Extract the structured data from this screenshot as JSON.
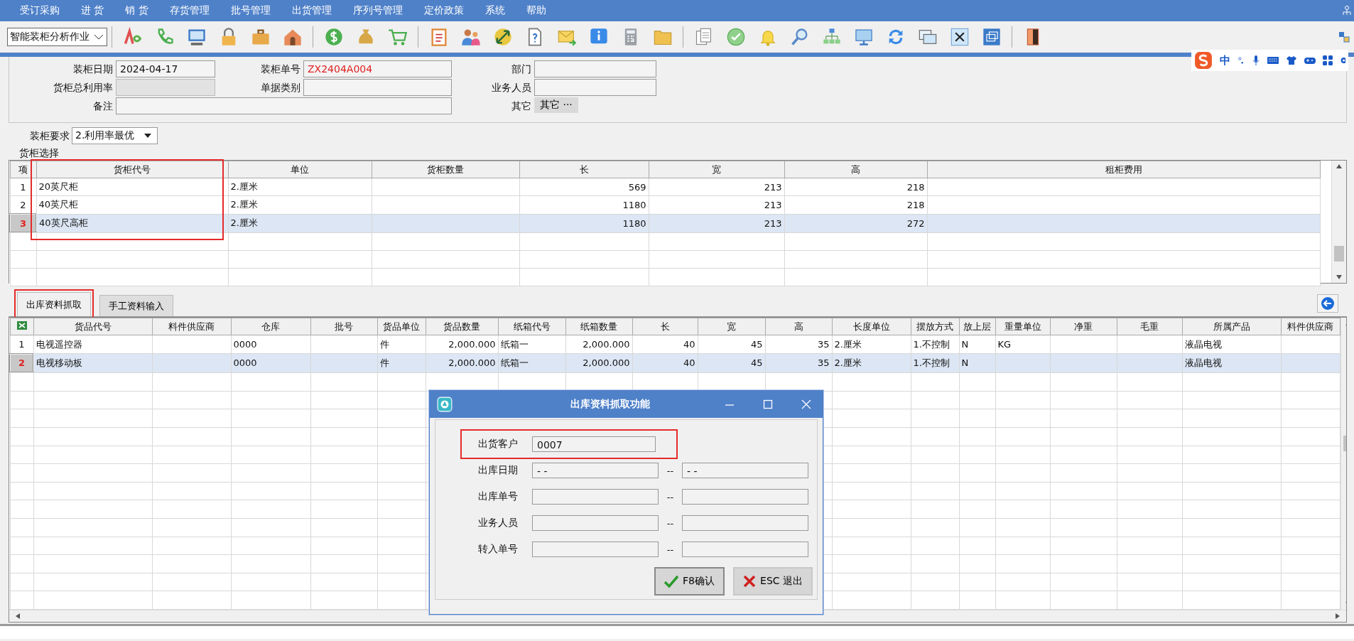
{
  "menu": [
    "受订采购",
    "进 货",
    "销 货",
    "存货管理",
    "批号管理",
    "出货管理",
    "序列号管理",
    "定价政策",
    "系统",
    "帮助"
  ],
  "toolbar": {
    "module_select": "智能装柜分析作业"
  },
  "ime_bar": {
    "mode": "中"
  },
  "form": {
    "fields": [
      {
        "label": "装柜日期",
        "value": "2024-04-17",
        "kind": "text"
      },
      {
        "label": "装柜单号",
        "value": "ZX2404A004",
        "kind": "code"
      },
      {
        "label": "部门",
        "kind": "text"
      },
      {
        "label": "货柜总利用率",
        "kind": "readonly"
      },
      {
        "label": "单据类别",
        "kind": "text"
      },
      {
        "label": "业务人员",
        "kind": "text"
      },
      {
        "label": "备注",
        "kind": "wide"
      },
      {
        "label": "其它",
        "value": "其它 ···",
        "kind": "button"
      }
    ]
  },
  "requirement": {
    "label": "装柜要求",
    "value": "2.利用率最优"
  },
  "container_section": {
    "title": "货柜选择",
    "columns": [
      {
        "label": "项",
        "kind": "index"
      },
      {
        "label": "货柜代号",
        "kind": "text"
      },
      {
        "label": "单位",
        "kind": "text"
      },
      {
        "label": "货柜数量",
        "kind": "number"
      },
      {
        "label": "长",
        "kind": "number"
      },
      {
        "label": "宽",
        "kind": "number"
      },
      {
        "label": "高",
        "kind": "number"
      },
      {
        "label": "租柜费用",
        "kind": "number"
      }
    ],
    "rows": [
      {
        "selected": false,
        "cells": [
          "1",
          "20英尺柜",
          "2.厘米",
          "",
          "569",
          "213",
          "218",
          ""
        ]
      },
      {
        "selected": false,
        "cells": [
          "2",
          "40英尺柜",
          "2.厘米",
          "",
          "1180",
          "213",
          "218",
          ""
        ]
      },
      {
        "selected": true,
        "cells": [
          "3",
          "40英尺高柜",
          "2.厘米",
          "",
          "1180",
          "213",
          "272",
          ""
        ]
      }
    ]
  },
  "tabs": [
    {
      "label": "出库资料抓取",
      "selected": true
    },
    {
      "label": "手工资料输入",
      "selected": false
    }
  ],
  "goods_table": {
    "columns": [
      {
        "kind": "index"
      },
      {
        "label": "货品代号",
        "kind": "text"
      },
      {
        "label": "料件供应商",
        "kind": "text"
      },
      {
        "label": "仓库",
        "kind": "text"
      },
      {
        "label": "批号",
        "kind": "text"
      },
      {
        "label": "货品单位",
        "kind": "text"
      },
      {
        "label": "货品数量",
        "kind": "number"
      },
      {
        "label": "纸箱代号",
        "kind": "text"
      },
      {
        "label": "纸箱数量",
        "kind": "number"
      },
      {
        "label": "长",
        "kind": "number"
      },
      {
        "label": "宽",
        "kind": "number"
      },
      {
        "label": "高",
        "kind": "number"
      },
      {
        "label": "长度单位",
        "kind": "text"
      },
      {
        "label": "摆放方式",
        "kind": "text"
      },
      {
        "label": "放上层",
        "kind": "text"
      },
      {
        "label": "重量单位",
        "kind": "text"
      },
      {
        "label": "净重",
        "kind": "number"
      },
      {
        "label": "毛重",
        "kind": "number"
      },
      {
        "label": "所属产品",
        "kind": "text"
      },
      {
        "label": "料件供应商",
        "kind": "text"
      }
    ],
    "rows": [
      {
        "selected": false,
        "cells": [
          "1",
          "电视遥控器",
          "",
          "0000",
          "",
          "件",
          "2,000.000",
          "纸箱一",
          "2,000.000",
          "40",
          "45",
          "35",
          "2.厘米",
          "1.不控制",
          "N",
          "KG",
          "",
          "",
          "液晶电视",
          ""
        ]
      },
      {
        "selected": true,
        "cells": [
          "2",
          "电视移动板",
          "",
          "0000",
          "",
          "件",
          "2,000.000",
          "纸箱一",
          "2,000.000",
          "40",
          "45",
          "35",
          "2.厘米",
          "1.不控制",
          "N",
          "",
          "",
          "",
          "液晶电视",
          ""
        ]
      }
    ]
  },
  "dialog": {
    "title": "出库资料抓取功能",
    "rows": [
      {
        "label": "出货客户",
        "kind": "single",
        "from": "0007"
      },
      {
        "label": "出库日期",
        "kind": "range",
        "from": "- -",
        "separator": "--",
        "to": "- -"
      },
      {
        "label": "出库单号",
        "kind": "range",
        "separator": "--"
      },
      {
        "label": "业务人员",
        "kind": "range",
        "separator": "--"
      },
      {
        "label": "转入单号",
        "kind": "range",
        "separator": "--"
      }
    ],
    "buttons": [
      {
        "label": "F8确认",
        "kind": "confirm"
      },
      {
        "label": "ESC 退出",
        "kind": "cancel"
      }
    ]
  }
}
